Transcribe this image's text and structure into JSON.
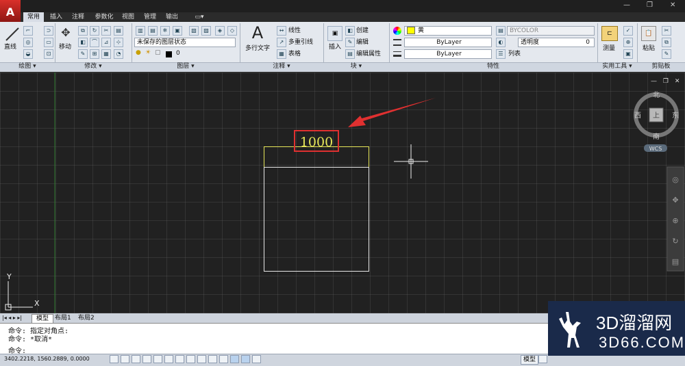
{
  "tabs": [
    "常用",
    "插入",
    "注释",
    "参数化",
    "视图",
    "管理",
    "输出"
  ],
  "panels": {
    "draw": {
      "label": "绘图",
      "line_label": "直线"
    },
    "modify": {
      "label": "修改",
      "move_label": "移动"
    },
    "layers": {
      "label": "图层",
      "layer_state": "未保存的图层状态",
      "layer_name": "0"
    },
    "annotation": {
      "label": "注释",
      "mtext_label": "多行文字",
      "linear_label": "线性",
      "mleader_label": "多重引线",
      "table_label": "表格"
    },
    "block": {
      "label": "块",
      "insert_label": "插入",
      "create_label": "创建",
      "edit_label": "编辑",
      "edit_attr_label": "编辑属性"
    },
    "properties": {
      "label": "特性",
      "color_value": "黄",
      "linetype_value": "ByLayer",
      "lineweight_value": "ByLayer",
      "plotstyle_value": "BYCOLOR",
      "transparency_label": "透明度",
      "transparency_value": "0",
      "list_label": "列表"
    },
    "utilities": {
      "label": "实用工具",
      "measure_label": "测量"
    },
    "clipboard": {
      "label": "剪贴板",
      "paste_label": "粘贴"
    }
  },
  "drawing": {
    "dimension_text": "1000"
  },
  "viewcube": {
    "north": "北",
    "south": "南",
    "east": "东",
    "west": "西",
    "top_label": "上",
    "wcs": "WCS"
  },
  "ucs": {
    "x": "X",
    "y": "Y"
  },
  "layout_tabs": [
    "模型",
    "布局1",
    "布局2"
  ],
  "command_history": [
    "命令: 指定对角点:",
    "命令: *取消*",
    "命令:"
  ],
  "status": {
    "coordinates": "3402.2218,  1560.2889,  0.0000",
    "model_label": "模型"
  },
  "watermark": {
    "text_cn": "3D溜溜网",
    "text_url": "3D66.COM"
  },
  "colors": {
    "canvas": "#212121",
    "dimension_yellow": "#e8e85a",
    "highlight_red": "#e03030",
    "rect_white": "#e8e8e8",
    "accent_yellow": "#ffff00"
  }
}
